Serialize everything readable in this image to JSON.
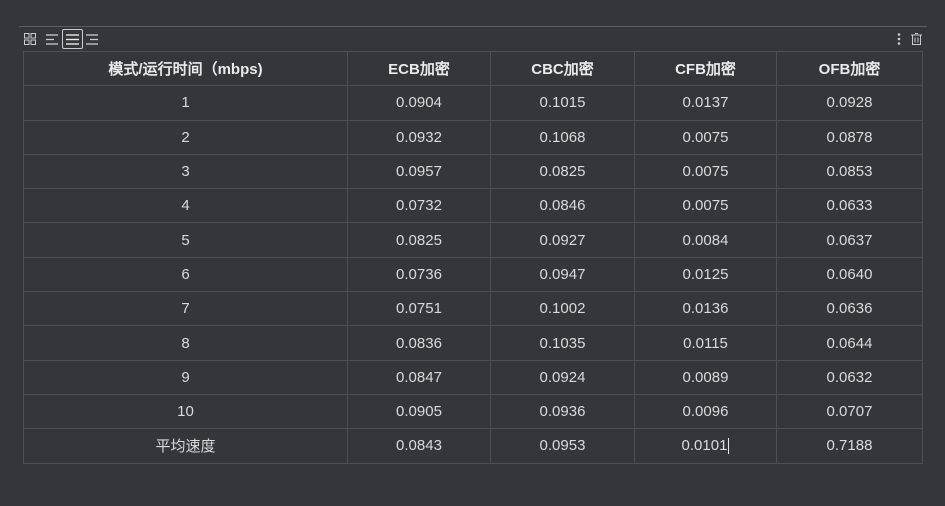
{
  "table": {
    "headers": [
      "模式/运行时间（mbps)",
      "ECB加密",
      "CBC加密",
      "CFB加密",
      "OFB加密"
    ],
    "rows": [
      [
        "1",
        "0.0904",
        "0.1015",
        "0.0137",
        "0.0928"
      ],
      [
        "2",
        "0.0932",
        "0.1068",
        "0.0075",
        "0.0878"
      ],
      [
        "3",
        "0.0957",
        "0.0825",
        "0.0075",
        "0.0853"
      ],
      [
        "4",
        "0.0732",
        "0.0846",
        "0.0075",
        "0.0633"
      ],
      [
        "5",
        "0.0825",
        "0.0927",
        "0.0084",
        "0.0637"
      ],
      [
        "6",
        "0.0736",
        "0.0947",
        "0.0125",
        "0.0640"
      ],
      [
        "7",
        "0.0751",
        "0.1002",
        "0.0136",
        "0.0636"
      ],
      [
        "8",
        "0.0836",
        "0.1035",
        "0.0115",
        "0.0644"
      ],
      [
        "9",
        "0.0847",
        "0.0924",
        "0.0089",
        "0.0632"
      ],
      [
        "10",
        "0.0905",
        "0.0936",
        "0.0096",
        "0.0707"
      ],
      [
        "平均速度",
        "0.0843",
        "0.0953",
        "0.0101",
        "0.7188"
      ]
    ]
  },
  "toolbar": {
    "icons": [
      "grid-icon",
      "align-left-icon",
      "align-center-icon",
      "align-right-icon",
      "more-vertical-icon",
      "trash-icon"
    ],
    "active": "align-center-icon"
  },
  "colors": {
    "background": "#33373b",
    "border": "#4b5055",
    "text": "#d8dadc"
  }
}
